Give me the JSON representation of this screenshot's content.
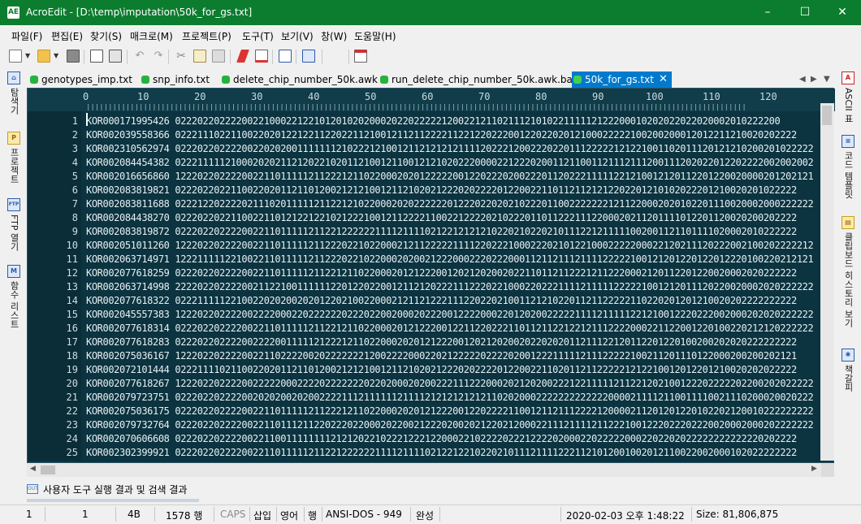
{
  "window": {
    "title": "AcroEdit - [D:\\temp\\imputation\\50k_for_gs.txt]",
    "app_icon": "AE",
    "title_color": "#0c7d2f",
    "controls": {
      "minimize": "–",
      "maximize": "☐",
      "close": "✕"
    }
  },
  "menu": {
    "items": [
      "파일(F)",
      "편집(E)",
      "찾기(S)",
      "매크로(M)",
      "프로젝트(P)",
      "도구(T)",
      "보기(V)",
      "창(W)",
      "도움말(H)"
    ]
  },
  "toolbar": {
    "icons": [
      "new-file-icon",
      "open-folder-icon",
      "save-icon",
      "print-preview-icon",
      "print-icon",
      "undo-icon",
      "redo-icon",
      "cut-icon",
      "copy-icon",
      "paste-icon",
      "highlighter-icon",
      "bookmark-icon",
      "export-icon",
      "columns-icon",
      "calendar-icon"
    ]
  },
  "left_panel": {
    "items": [
      {
        "label": "탐색기",
        "icon": "explorer-icon",
        "glyph": "⌂"
      },
      {
        "label": "프로젝트",
        "icon": "project-icon",
        "glyph": "P"
      },
      {
        "label": "FTP 열기",
        "icon": "ftp-icon",
        "glyph": "FTP"
      },
      {
        "label": "함수 리스트",
        "icon": "function-list-icon",
        "glyph": "M"
      }
    ]
  },
  "right_panel": {
    "items": [
      {
        "label": "ASCII 표",
        "icon": "ascii-icon",
        "glyph": "A"
      },
      {
        "label": "코드 템플릿",
        "icon": "code-template-icon",
        "glyph": "≡"
      },
      {
        "label": "클립보드 히스토리 보기",
        "icon": "clipboard-icon",
        "glyph": "▤"
      },
      {
        "label": "책갈피",
        "icon": "bookmark-panel-icon",
        "glyph": "✱"
      }
    ]
  },
  "tabs": [
    {
      "label": "genotypes_imp.txt",
      "active": false
    },
    {
      "label": "snp_info.txt",
      "active": false
    },
    {
      "label": "delete_chip_number_50k.awk",
      "active": false
    },
    {
      "label": "run_delete_chip_number_50k.awk.bat",
      "active": false
    },
    {
      "label": "50k_for_gs.txt",
      "active": true,
      "close": "✕"
    }
  ],
  "tab_nav": {
    "prev": "◀",
    "next": "▶",
    "menu": "▼"
  },
  "ruler": {
    "numbers": [
      "0",
      "10",
      "20",
      "30",
      "40",
      "50",
      "60",
      "70",
      "80",
      "90",
      "100",
      "110",
      "120"
    ]
  },
  "editor": {
    "lines": [
      {
        "n": "1",
        "text": "KOR000171995426 0222022022220022100022122101201020200020220222221200221211021112101022111112122200010202022022020002010222200"
      },
      {
        "n": "2",
        "text": "KOR002039558366 0222111022110022020122122112202211210012112112222112212202220012202202012100022222100200200012012211210020202222"
      },
      {
        "n": "3",
        "text": "KOR002310562974 0222022022220022020200111111121022212100121121212121111202221200222022011122222121221001102011120121210200201022222"
      },
      {
        "n": "4",
        "text": "KOR002084454382 0222111112100020202112120221020112100121100121210202220000221222020011211001121112111200111202022012202222002002002"
      },
      {
        "n": "5",
        "text": "KOR002016656860 1222022022220022110111112112221211022000202012222200122022202002220112022211111221210012120112201220020000201202121"
      },
      {
        "n": "6",
        "text": "KOR002083819821 0222022022110022020112110120021212100121121020212220202222012200221101121121212202201210102022201210020201022222"
      },
      {
        "n": "7",
        "text": "KOR002083811688 0222122022220211102011111211221210220002020222222012220220202102220110022222221211220002020102201110020002000222222"
      },
      {
        "n": "8",
        "text": "KOR002084438270 0222022022110022110121221221021222100121122221100221222202102220110112221112200020211201111012201120020200202222"
      },
      {
        "n": "9",
        "text": "KOR002083819872 0222022022220022110111112112212222221111211110212212121210220210220210111221211111002001121101111020002010222222"
      },
      {
        "n": "10",
        "text": "KOR002051011260 1222022022220022110111112112220221022000212112222211112202221000222021012210002222200022120211120222002100202222212"
      },
      {
        "n": "11",
        "text": "KOR002063714971 1222111112210022110111112112220221022000202002122200022202220001121121112111122222100121201220122012220100220212121"
      },
      {
        "n": "12",
        "text": "KOR002077618259 0222022022220022110111112112212110220002012122200120212020020221101121122212112220002120112201220020002020222222"
      },
      {
        "n": "13",
        "text": "KOR002063714998 2222022022220021122100111111220122022001211212022211122202210002202221111211111222221001212011120220020002020222222"
      },
      {
        "n": "14",
        "text": "KOR002077618322 0222111112210022020200202012202100220002121121222111220220210011212102201121122222110220201201210020202222222222"
      },
      {
        "n": "15",
        "text": "KOR002045557383 1222022022220022220002202222220222022002000202220012222000220120200222221111211111221210012220222002000202020222222"
      },
      {
        "n": "16",
        "text": "KOR002077618314 0222022022220022110111112112212110220002012122200122112202221101121122122121112222000221122001220100220212120222222"
      },
      {
        "n": "17",
        "text": "KOR002077618283 0222022022220022220011111212221211022000202012122200120212020020220202011211122120112201220100200202020222222222"
      },
      {
        "n": "18",
        "text": "KOR002075036167 1222022022220022110222200202222222120022220002202122222022220200122211111211122222100211201110122000200200202121"
      },
      {
        "n": "19",
        "text": "KOR002072101444 0222111102110022020112110120021212100121121020212220202222012200221102011211222221212210012012201210020202022222"
      },
      {
        "n": "20",
        "text": "KOR002077618267 1222022022220022222000222202222222022020002020022211122200020212020022212211111211221202100122202222202200202022222"
      },
      {
        "n": "21",
        "text": "KOR002079723751 0222022022220020202002020022221112111111211112121212121211020200022222222222220000211112110011110021110200020020222"
      },
      {
        "n": "22",
        "text": "KOR002075036175 0222022022220022110111112112221211022000202012122200122022221100121121112222120000211201201220102202120010222222222"
      },
      {
        "n": "23",
        "text": "KOR002079732764 0222022022220022110111211220222022000202200212220200202122021200022111211112112221001222022202220020002000202222222"
      },
      {
        "n": "24",
        "text": "KOR002070606608 0222022022220022110011111111212120221022212221220002210222202221222202000220222220002202202022222222222220202222"
      },
      {
        "n": "25",
        "text": "KOR002302399921 0222022022220022110111112112212222221111211110212212210220210111211112221121012001002012110022002000102022222222"
      }
    ]
  },
  "output_panel": {
    "label": "사용자 도구 실행 결과 및 검색 결과",
    "icon_text": "OUT"
  },
  "statusbar": {
    "line": "1",
    "column": "1",
    "char_hex": "4B",
    "total_lines": "1578 행",
    "caps": "CAPS",
    "insert": "삽입",
    "lang": "영어",
    "mode": "행",
    "encoding": "ANSI-DOS - 949",
    "complete": "완성",
    "datetime": "2020-02-03 오후 1:48:22",
    "size": "Size: 81,806,875"
  }
}
